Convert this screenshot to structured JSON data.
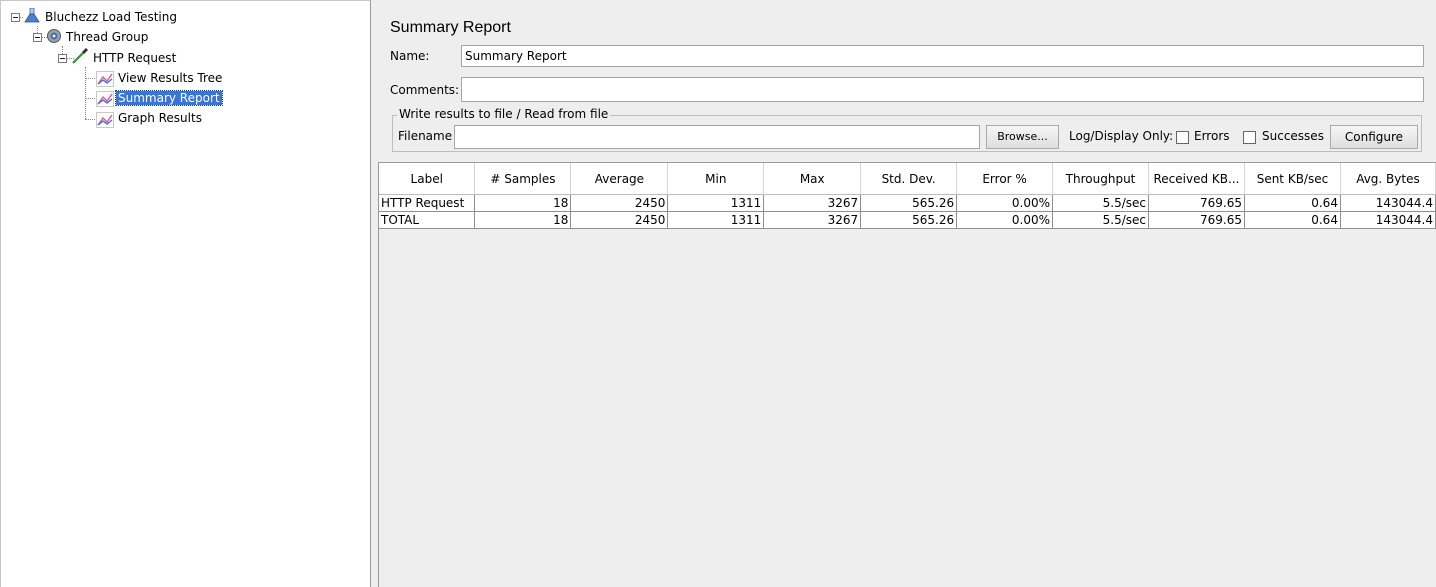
{
  "tree": {
    "root": {
      "label": "Bluchezz Load Testing",
      "icon": "flask-icon"
    },
    "thread_group": {
      "label": "Thread Group",
      "icon": "gear-icon"
    },
    "http_request": {
      "label": "HTTP Request",
      "icon": "pipette-icon"
    },
    "listeners": [
      {
        "label": "View Results Tree",
        "icon": "graph-icon",
        "selected": false
      },
      {
        "label": "Summary Report",
        "icon": "graph-icon",
        "selected": true
      },
      {
        "label": "Graph Results",
        "icon": "graph-icon",
        "selected": false
      }
    ]
  },
  "panel": {
    "title": "Summary Report",
    "name_label": "Name:",
    "name_value": "Summary Report",
    "comments_label": "Comments:",
    "comments_value": "",
    "file_group_title": "Write results to file / Read from file",
    "filename_label": "Filename",
    "filename_value": "",
    "browse_label": "Browse...",
    "log_display_label": "Log/Display Only:",
    "errors_label": "Errors",
    "successes_label": "Successes",
    "configure_label": "Configure"
  },
  "table": {
    "headers": [
      "Label",
      "# Samples",
      "Average",
      "Min",
      "Max",
      "Std. Dev.",
      "Error %",
      "Throughput",
      "Received KB...",
      "Sent KB/sec",
      "Avg. Bytes"
    ],
    "rows": [
      [
        "HTTP Request",
        "18",
        "2450",
        "1311",
        "3267",
        "565.26",
        "0.00%",
        "5.5/sec",
        "769.65",
        "0.64",
        "143044.4"
      ],
      [
        "TOTAL",
        "18",
        "2450",
        "1311",
        "3267",
        "565.26",
        "0.00%",
        "5.5/sec",
        "769.65",
        "0.64",
        "143044.4"
      ]
    ]
  },
  "colors": {
    "selection": "#3875d7",
    "background": "#eeeeee"
  }
}
